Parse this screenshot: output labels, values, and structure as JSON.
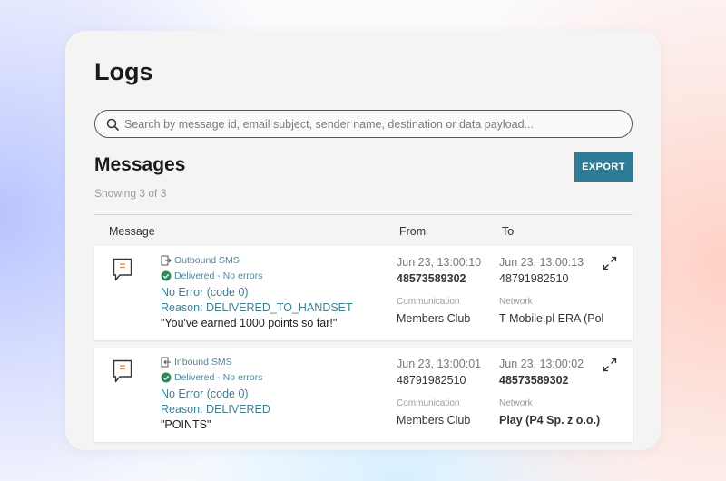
{
  "page": {
    "title": "Logs"
  },
  "search": {
    "placeholder": "Search by message id, email subject, sender name, destination or data payload..."
  },
  "messages": {
    "title": "Messages",
    "export_label": "EXPORT",
    "count_text": "Showing 3 of 3",
    "columns": {
      "message": "Message",
      "from": "From",
      "to": "To"
    },
    "rows": [
      {
        "type": "Outbound SMS",
        "status": "Delivered - No errors",
        "code": "No Error (code 0)",
        "reason": "Reason: DELIVERED_TO_HANDSET",
        "payload": "\"You've earned 1000 points so far!\"",
        "from_time": "Jun 23, 13:00:10",
        "from_number": "48573589302",
        "from_label": "Communication",
        "from_value": "Members Club",
        "to_time": "Jun 23, 13:00:13",
        "to_number": "48791982510",
        "to_label": "Network",
        "to_value": "T-Mobile.pl ERA (Pols"
      },
      {
        "type": "Inbound SMS",
        "status": "Delivered - No errors",
        "code": "No Error (code 0)",
        "reason": "Reason: DELIVERED",
        "payload": "\"POINTS\"",
        "from_time": "Jun 23, 13:00:01",
        "from_number": "48791982510",
        "from_label": "Communication",
        "from_value": "Members Club",
        "to_time": "Jun 23, 13:00:02",
        "to_number": "48573589302",
        "to_label": "Network",
        "to_value": "Play (P4 Sp. z o.o.)"
      }
    ]
  },
  "colors": {
    "accent": "#2f7a96",
    "status_green": "#2e8b57",
    "teal_text": "#3f7f92"
  },
  "icons": [
    "search-icon",
    "message-icon",
    "outbound-icon",
    "inbound-icon",
    "check-circle-icon",
    "expand-icon"
  ]
}
